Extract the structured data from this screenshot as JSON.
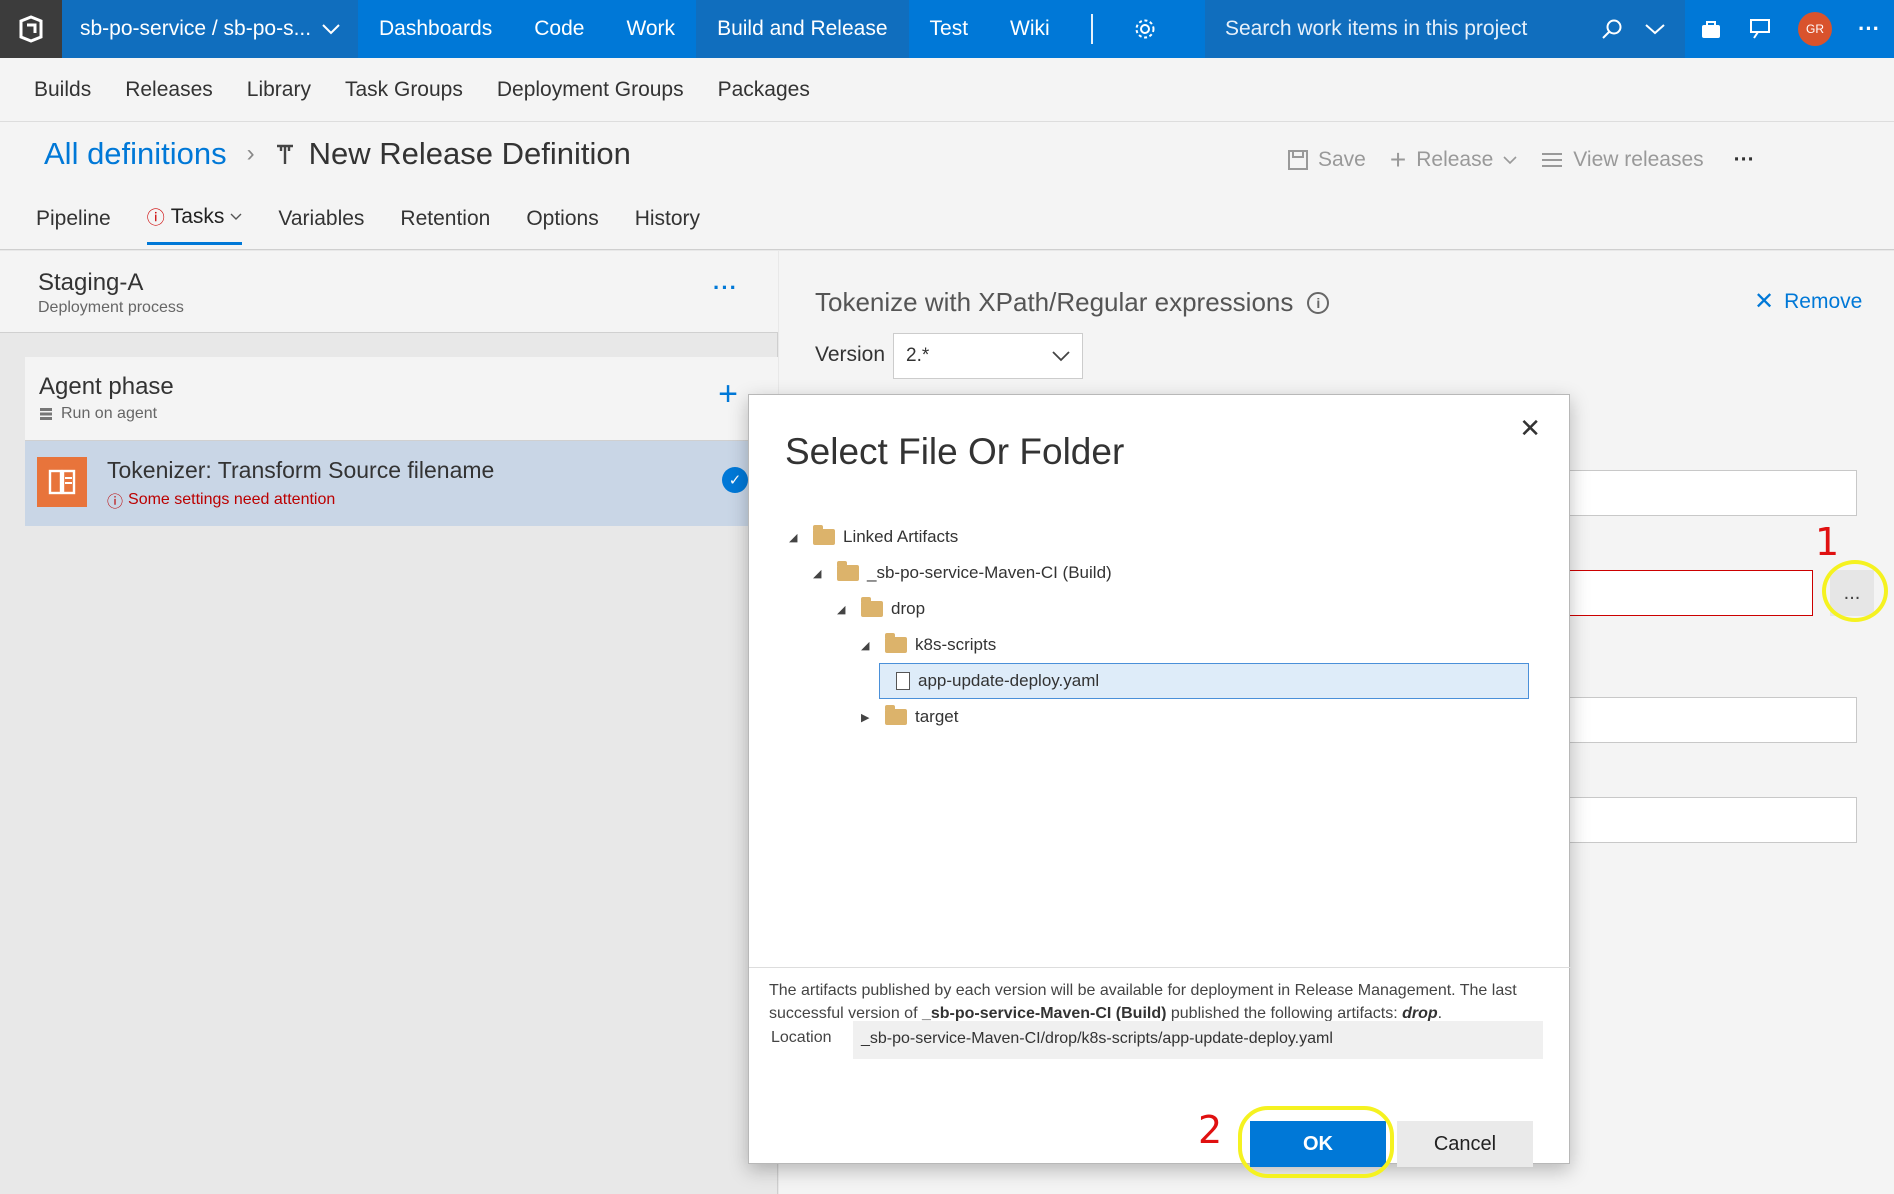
{
  "topbar": {
    "project": "sb-po-service / sb-po-s...",
    "nav": [
      "Dashboards",
      "Code",
      "Work",
      "Build and Release",
      "Test",
      "Wiki"
    ],
    "active_nav": "Build and Release",
    "search_placeholder": "Search work items in this project",
    "avatar_initials": "GR"
  },
  "subnav": [
    "Builds",
    "Releases",
    "Library",
    "Task Groups",
    "Deployment Groups",
    "Packages"
  ],
  "header": {
    "breadcrumb_root": "All definitions",
    "title": "New Release Definition",
    "save": "Save",
    "release": "Release",
    "view_releases": "View releases",
    "more": "···"
  },
  "tabs": [
    "Pipeline",
    "Tasks",
    "Variables",
    "Retention",
    "Options",
    "History"
  ],
  "active_tab": "Tasks",
  "left": {
    "stage_name": "Staging-A",
    "stage_sub": "Deployment process",
    "phase_name": "Agent phase",
    "phase_sub": "Run on agent",
    "task_name": "Tokenizer: Transform Source filename",
    "task_warning": "Some settings need attention"
  },
  "right": {
    "task_title": "Tokenize with XPath/Regular expressions",
    "remove": "Remove",
    "version_label": "Version",
    "version_value": "2.*",
    "ellipsis": "..."
  },
  "dialog": {
    "title": "Select File Or Folder",
    "tree": [
      {
        "label": "Linked Artifacts",
        "type": "folder",
        "depth": 0,
        "expanded": true
      },
      {
        "label": "_sb-po-service-Maven-CI (Build)",
        "type": "folder",
        "depth": 1,
        "expanded": true
      },
      {
        "label": "drop",
        "type": "folder",
        "depth": 2,
        "expanded": true
      },
      {
        "label": "k8s-scripts",
        "type": "folder",
        "depth": 3,
        "expanded": true
      },
      {
        "label": "app-update-deploy.yaml",
        "type": "file",
        "depth": 4,
        "selected": true
      },
      {
        "label": "target",
        "type": "folder",
        "depth": 3,
        "expanded": false
      }
    ],
    "desc_1": "The artifacts published by each version will be available for deployment in Release Management. The last successful version of ",
    "desc_build": "_sb-po-service-Maven-CI (Build)",
    "desc_2": " published the following artifacts: ",
    "desc_artifact": "drop",
    "desc_end": ".",
    "location_label": "Location",
    "location_value": "_sb-po-service-Maven-CI/drop/k8s-scripts/app-update-deploy.yaml",
    "ok": "OK",
    "cancel": "Cancel"
  },
  "annotations": {
    "step1": "1",
    "step2": "2",
    "color": "#e01010",
    "highlight_color": "#f5f220"
  }
}
